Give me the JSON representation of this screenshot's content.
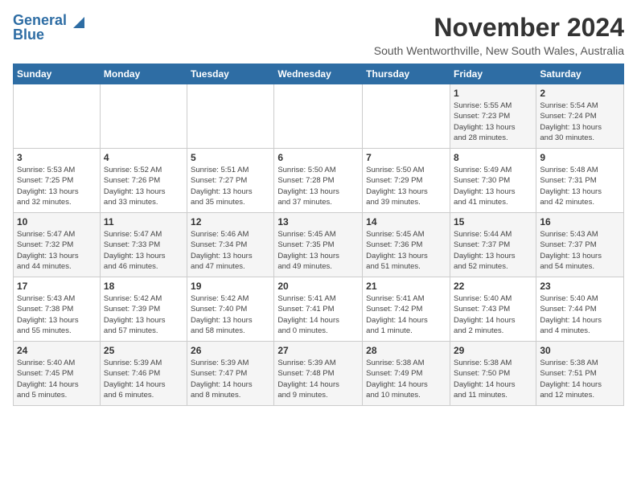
{
  "logo": {
    "line1": "General",
    "line2": "Blue"
  },
  "title": "November 2024",
  "subtitle": "South Wentworthville, New South Wales, Australia",
  "weekdays": [
    "Sunday",
    "Monday",
    "Tuesday",
    "Wednesday",
    "Thursday",
    "Friday",
    "Saturday"
  ],
  "weeks": [
    [
      {
        "day": "",
        "info": ""
      },
      {
        "day": "",
        "info": ""
      },
      {
        "day": "",
        "info": ""
      },
      {
        "day": "",
        "info": ""
      },
      {
        "day": "",
        "info": ""
      },
      {
        "day": "1",
        "info": "Sunrise: 5:55 AM\nSunset: 7:23 PM\nDaylight: 13 hours\nand 28 minutes."
      },
      {
        "day": "2",
        "info": "Sunrise: 5:54 AM\nSunset: 7:24 PM\nDaylight: 13 hours\nand 30 minutes."
      }
    ],
    [
      {
        "day": "3",
        "info": "Sunrise: 5:53 AM\nSunset: 7:25 PM\nDaylight: 13 hours\nand 32 minutes."
      },
      {
        "day": "4",
        "info": "Sunrise: 5:52 AM\nSunset: 7:26 PM\nDaylight: 13 hours\nand 33 minutes."
      },
      {
        "day": "5",
        "info": "Sunrise: 5:51 AM\nSunset: 7:27 PM\nDaylight: 13 hours\nand 35 minutes."
      },
      {
        "day": "6",
        "info": "Sunrise: 5:50 AM\nSunset: 7:28 PM\nDaylight: 13 hours\nand 37 minutes."
      },
      {
        "day": "7",
        "info": "Sunrise: 5:50 AM\nSunset: 7:29 PM\nDaylight: 13 hours\nand 39 minutes."
      },
      {
        "day": "8",
        "info": "Sunrise: 5:49 AM\nSunset: 7:30 PM\nDaylight: 13 hours\nand 41 minutes."
      },
      {
        "day": "9",
        "info": "Sunrise: 5:48 AM\nSunset: 7:31 PM\nDaylight: 13 hours\nand 42 minutes."
      }
    ],
    [
      {
        "day": "10",
        "info": "Sunrise: 5:47 AM\nSunset: 7:32 PM\nDaylight: 13 hours\nand 44 minutes."
      },
      {
        "day": "11",
        "info": "Sunrise: 5:47 AM\nSunset: 7:33 PM\nDaylight: 13 hours\nand 46 minutes."
      },
      {
        "day": "12",
        "info": "Sunrise: 5:46 AM\nSunset: 7:34 PM\nDaylight: 13 hours\nand 47 minutes."
      },
      {
        "day": "13",
        "info": "Sunrise: 5:45 AM\nSunset: 7:35 PM\nDaylight: 13 hours\nand 49 minutes."
      },
      {
        "day": "14",
        "info": "Sunrise: 5:45 AM\nSunset: 7:36 PM\nDaylight: 13 hours\nand 51 minutes."
      },
      {
        "day": "15",
        "info": "Sunrise: 5:44 AM\nSunset: 7:37 PM\nDaylight: 13 hours\nand 52 minutes."
      },
      {
        "day": "16",
        "info": "Sunrise: 5:43 AM\nSunset: 7:37 PM\nDaylight: 13 hours\nand 54 minutes."
      }
    ],
    [
      {
        "day": "17",
        "info": "Sunrise: 5:43 AM\nSunset: 7:38 PM\nDaylight: 13 hours\nand 55 minutes."
      },
      {
        "day": "18",
        "info": "Sunrise: 5:42 AM\nSunset: 7:39 PM\nDaylight: 13 hours\nand 57 minutes."
      },
      {
        "day": "19",
        "info": "Sunrise: 5:42 AM\nSunset: 7:40 PM\nDaylight: 13 hours\nand 58 minutes."
      },
      {
        "day": "20",
        "info": "Sunrise: 5:41 AM\nSunset: 7:41 PM\nDaylight: 14 hours\nand 0 minutes."
      },
      {
        "day": "21",
        "info": "Sunrise: 5:41 AM\nSunset: 7:42 PM\nDaylight: 14 hours\nand 1 minute."
      },
      {
        "day": "22",
        "info": "Sunrise: 5:40 AM\nSunset: 7:43 PM\nDaylight: 14 hours\nand 2 minutes."
      },
      {
        "day": "23",
        "info": "Sunrise: 5:40 AM\nSunset: 7:44 PM\nDaylight: 14 hours\nand 4 minutes."
      }
    ],
    [
      {
        "day": "24",
        "info": "Sunrise: 5:40 AM\nSunset: 7:45 PM\nDaylight: 14 hours\nand 5 minutes."
      },
      {
        "day": "25",
        "info": "Sunrise: 5:39 AM\nSunset: 7:46 PM\nDaylight: 14 hours\nand 6 minutes."
      },
      {
        "day": "26",
        "info": "Sunrise: 5:39 AM\nSunset: 7:47 PM\nDaylight: 14 hours\nand 8 minutes."
      },
      {
        "day": "27",
        "info": "Sunrise: 5:39 AM\nSunset: 7:48 PM\nDaylight: 14 hours\nand 9 minutes."
      },
      {
        "day": "28",
        "info": "Sunrise: 5:38 AM\nSunset: 7:49 PM\nDaylight: 14 hours\nand 10 minutes."
      },
      {
        "day": "29",
        "info": "Sunrise: 5:38 AM\nSunset: 7:50 PM\nDaylight: 14 hours\nand 11 minutes."
      },
      {
        "day": "30",
        "info": "Sunrise: 5:38 AM\nSunset: 7:51 PM\nDaylight: 14 hours\nand 12 minutes."
      }
    ]
  ]
}
